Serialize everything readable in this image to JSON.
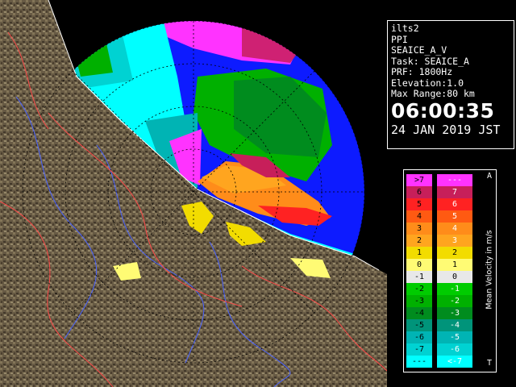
{
  "station": "ilts2",
  "product": "PPI",
  "scan_name": "SEAICE_A_V",
  "task": "Task: SEAICE_A",
  "prf": "PRF: 1800Hz",
  "elevation": "Elevation:1.0",
  "max_range": "Max Range:80 km",
  "time": "06:00:35",
  "date": "24 JAN 2019 JST",
  "legend": {
    "title": "Mean Velocity in m/s",
    "top_marker": "A",
    "bottom_marker": "T",
    "left_labels": [
      ">7",
      "6",
      "5",
      "4",
      "3",
      "2",
      "1",
      "0",
      "-1",
      "-2",
      "-3",
      "-4",
      "-5",
      "-6",
      "-7",
      "---"
    ],
    "right_labels": [
      "---",
      "7",
      "6",
      "5",
      "4",
      "3",
      "2",
      "1",
      "0",
      "-1",
      "-2",
      "-3",
      "-4",
      "-5",
      "-6",
      "<-7"
    ],
    "colors": [
      "#ff33ff",
      "#c71f5a",
      "#ff2222",
      "#ff5a12",
      "#ff8c1a",
      "#ffa51f",
      "#f2dc00",
      "#fffb74",
      "#e8e8e8",
      "#00cc00",
      "#00b000",
      "#008c1e",
      "#00947a",
      "#00b4b4",
      "#00d2d2",
      "#00ffff"
    ]
  },
  "colors": {
    "sea": "#0d1bff",
    "land": "#7a6a50",
    "range_ring": "#000000"
  }
}
